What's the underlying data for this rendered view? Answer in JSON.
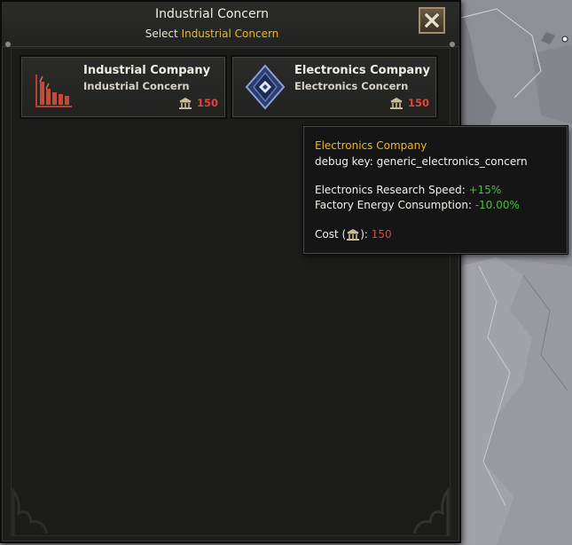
{
  "dialog": {
    "title": "Industrial Concern",
    "subtitle_prefix": "Select ",
    "subtitle_highlight": "Industrial Concern"
  },
  "companies": [
    {
      "name": "Industrial Company",
      "type": "Industrial Concern",
      "cost": "150",
      "icon": "factory-chart-icon"
    },
    {
      "name": "Electronics Company",
      "type": "Electronics Concern",
      "cost": "150",
      "icon": "electronics-diamond-icon"
    }
  ],
  "tooltip": {
    "title": "Electronics Company",
    "debug_label": "debug key: ",
    "debug_key": "generic_electronics_concern",
    "modifier1_label": "Electronics Research Speed: ",
    "modifier1_value": "+15%",
    "modifier2_label": "Factory Energy Consumption: ",
    "modifier2_value": "-10.00%",
    "cost_label_prefix": "Cost (",
    "cost_label_suffix": "): ",
    "cost_value": "150"
  },
  "colors": {
    "highlight": "#f0b61d",
    "cost_red": "#e0463a",
    "positive_green": "#42c23a"
  },
  "icons": {
    "close": "close-x-icon",
    "cost": "political-power-building-icon"
  }
}
